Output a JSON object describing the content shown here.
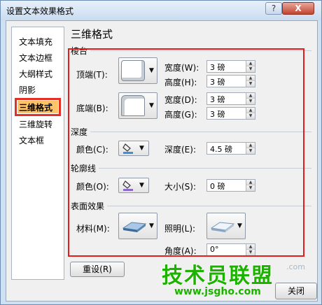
{
  "window": {
    "title": "设置文本效果格式",
    "help_label": "?",
    "close_label": "X"
  },
  "nav": {
    "items": [
      {
        "label": "文本填充"
      },
      {
        "label": "文本边框"
      },
      {
        "label": "大纲样式"
      },
      {
        "label": "阴影"
      },
      {
        "label": "三维格式",
        "selected": true
      },
      {
        "label": "三维旋转"
      },
      {
        "label": "文本框"
      }
    ]
  },
  "panel": {
    "title": "三维格式",
    "bevel": {
      "section_label": "棱台",
      "top_label": "顶端(T):",
      "bottom_label": "底端(B):",
      "top_width_label": "宽度(W):",
      "top_width_value": "3 磅",
      "top_height_label": "高度(H):",
      "top_height_value": "3 磅",
      "bottom_width_label": "宽度(D):",
      "bottom_width_value": "3 磅",
      "bottom_height_label": "高度(G):",
      "bottom_height_value": "3 磅"
    },
    "depth": {
      "section_label": "深度",
      "color_label": "颜色(C):",
      "depth_label": "深度(E):",
      "depth_value": "4.5 磅"
    },
    "contour": {
      "section_label": "轮廓线",
      "color_label": "颜色(O):",
      "size_label": "大小(S):",
      "size_value": "0 磅"
    },
    "surface": {
      "section_label": "表面效果",
      "material_label": "材料(M):",
      "lighting_label": "照明(L):",
      "angle_label": "角度(A):",
      "angle_value": "0°"
    }
  },
  "buttons": {
    "reset_label": "重设(R)",
    "close_label": "关闭"
  },
  "watermark": {
    "big": "技术员联盟",
    "small": "www.jsgho.com",
    "com": ".com"
  },
  "colors": {
    "highlight": "#e11d1d",
    "selected_fill": "#ffc36a",
    "depth_swatch": "#3f8fd8",
    "contour_swatch": "#8e68c8",
    "watermark": "#1db200"
  },
  "icons": {
    "bevel_top": "bevel-preset-icon",
    "bevel_bottom": "bevel-preset-icon",
    "depth_color": "paint-bucket-icon",
    "contour_color": "paint-bucket-icon",
    "material": "material-preset-icon",
    "lighting": "lighting-preset-icon"
  }
}
